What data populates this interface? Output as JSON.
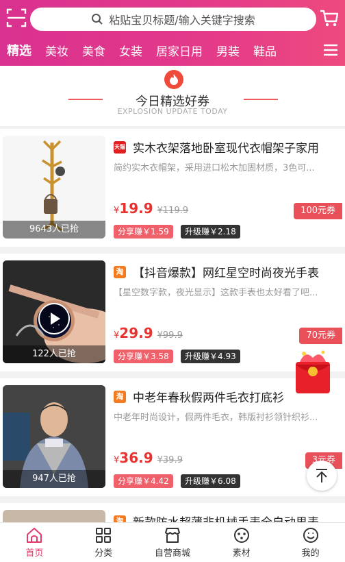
{
  "header": {
    "search_placeholder": "粘贴宝贝标题/输入关键字搜索",
    "tabs": [
      "精选",
      "美妆",
      "美食",
      "女装",
      "居家日用",
      "男装",
      "鞋品"
    ],
    "active_tab": "精选",
    "icons": [
      "scan-icon",
      "search-icon",
      "cart-icon",
      "menu-icon"
    ]
  },
  "section": {
    "title": "今日精选好券",
    "subtitle": "EXPLOSION UPDATE TODAY",
    "icon": "fire-icon"
  },
  "products": [
    {
      "platform": "天猫",
      "title": "实木衣架落地卧室现代衣帽架子家用",
      "desc": "简约实木衣帽架，采用进口松木加固材质，3色可...",
      "currency": "¥",
      "price": "19.9",
      "orig_price": "¥119.9",
      "coupon": "100元券",
      "share": "分享赚￥1.59",
      "upgrade": "升级赚￥2.18",
      "sold": "9643人已抢"
    },
    {
      "platform": "淘",
      "title": "【抖音爆款】网红星空时尚夜光手表",
      "desc": "【星空数字款，夜光显示】这款手表也太好看了吧...",
      "currency": "¥",
      "price": "29.9",
      "orig_price": "¥99.9",
      "coupon": "70元券",
      "share": "分享赚￥3.58",
      "upgrade": "升级赚￥4.93",
      "sold": "122人已抢"
    },
    {
      "platform": "淘",
      "title": "中老年春秋假两件毛衣打底衫",
      "desc": "中老年时尚设计，假两件毛衣，韩版衬衫领针织衫...",
      "currency": "¥",
      "price": "36.9",
      "orig_price": "¥39.9",
      "coupon": "3元券",
      "share": "分享赚￥4.42",
      "upgrade": "升级赚￥6.08",
      "sold": "947人已抢"
    },
    {
      "platform": "淘",
      "title": "新款防水超薄非机械手表全自动男表"
    }
  ],
  "bottom_nav": [
    {
      "label": "首页",
      "icon": "home-icon"
    },
    {
      "label": "分类",
      "icon": "grid-icon"
    },
    {
      "label": "自营商城",
      "icon": "store-icon"
    },
    {
      "label": "素材",
      "icon": "material-icon"
    },
    {
      "label": "我的",
      "icon": "profile-icon"
    }
  ],
  "colors": {
    "brand": "#e43a8a",
    "price": "#e8322f",
    "coupon": "#e9505a"
  }
}
